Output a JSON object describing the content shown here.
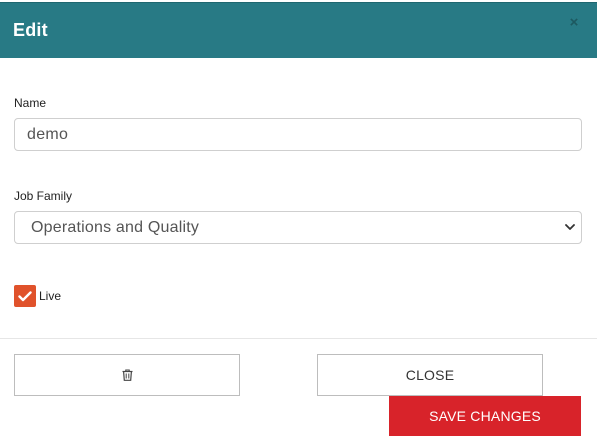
{
  "dialog": {
    "title": "Edit",
    "close_glyph": "×"
  },
  "form": {
    "name": {
      "label": "Name",
      "value": "demo"
    },
    "job_family": {
      "label": "Job Family",
      "selected": "Operations and Quality"
    },
    "live": {
      "label": "Live",
      "checked": true
    }
  },
  "footer": {
    "delete_icon": "trash-icon",
    "close_label": "CLOSE",
    "save_label": "SAVE CHANGES"
  },
  "colors": {
    "header": "#287a85",
    "checkbox": "#e0522b",
    "save_button": "#d8232a"
  }
}
